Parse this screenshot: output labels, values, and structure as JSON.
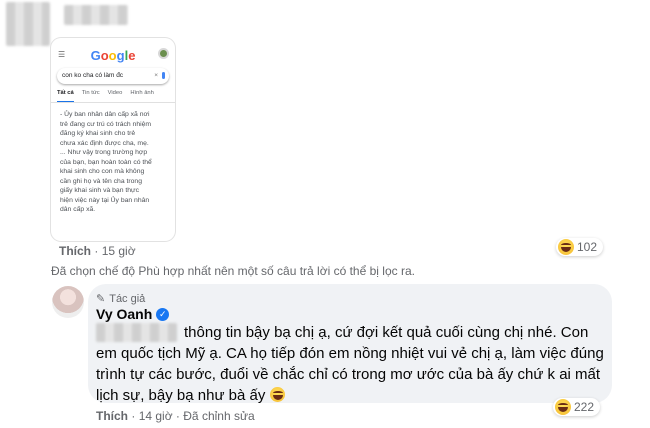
{
  "top_comment": {
    "screenshot": {
      "logo": "Google",
      "search_query": "con ko cha có làm đc",
      "clear_symbol": "×",
      "tabs": [
        "Tất cả",
        "Tin tức",
        "Video",
        "Hình ảnh"
      ],
      "snippet_lines": [
        "- Ủy ban nhân dân cấp xã nơi",
        "trẻ đang cư trú có trách nhiệm",
        "đăng ký khai sinh cho trẻ",
        "chưa xác định được cha, mẹ.",
        "... Như vậy trong trường hợp",
        "của bạn, bạn hoàn toàn có thể",
        "khai sinh cho con mà không",
        "cần ghi họ và tên cha trong",
        "giấy khai sinh và bạn thực",
        "hiện việc này tại Ủy ban nhân",
        "dân cấp xã."
      ]
    },
    "like_label": "Thích",
    "time": "15 giờ",
    "reaction_count": "102"
  },
  "filter_notice": "Đã chọn chế độ Phù hợp nhất nên một số câu trả lời có thể bị lọc ra.",
  "reply": {
    "author_badge": "Tác giả",
    "name": "Vy Oanh",
    "text": "thông tin bậy bạ chị ạ, cứ đợi kết quả cuối cùng chị nhé. Con em quốc tịch Mỹ ạ. CA họ tiếp đón em nồng nhiệt vui vẻ chị ạ, làm việc đúng trình tự các bước, đuổi về chắc chỉ có trong mơ ước của bà ấy chứ k ai mất lịch sự, bậy bạ như bà ấy",
    "like_label": "Thích",
    "time": "14 giờ",
    "edited": "Đã chỉnh sửa",
    "separator": "·",
    "reaction_count": "222"
  },
  "colors": {
    "meta": "#65676b",
    "bubble": "#f0f2f5",
    "verified": "#1877f2"
  }
}
